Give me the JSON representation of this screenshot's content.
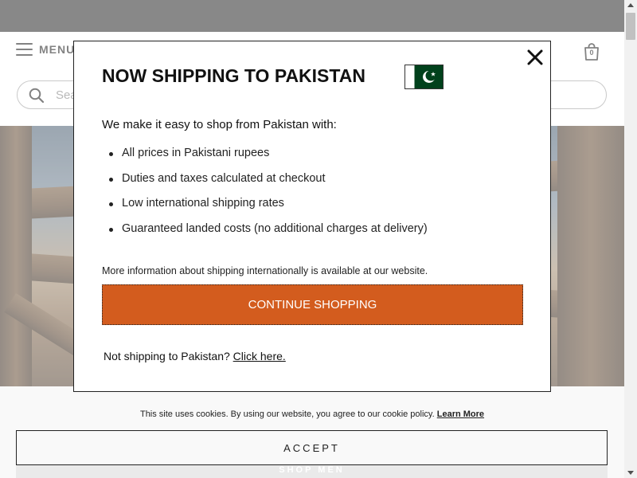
{
  "header": {
    "menu_label": "MENU",
    "cart_count": "0",
    "cart_icon": "shopping-bag-icon",
    "menu_icon": "hamburger-icon"
  },
  "search": {
    "placeholder": "Search",
    "icon": "search-icon"
  },
  "modal": {
    "title": "NOW SHIPPING TO PAKISTAN",
    "flag": "pakistan-flag-icon",
    "close_icon": "close-icon",
    "intro": "We make it easy to shop from Pakistan with:",
    "bullets": [
      "All prices in Pakistani rupees",
      "Duties and taxes calculated at checkout",
      "Low international shipping rates",
      "Guaranteed landed costs (no additional charges at delivery)"
    ],
    "info": "More information about shipping internationally is available at our website.",
    "continue_label": "CONTINUE SHOPPING",
    "not_shipping_text": "Not shipping to Pakistan?",
    "click_here_label": "Click here."
  },
  "cookie": {
    "text": "This site uses cookies. By using our website, you agree to our cookie policy.",
    "learn_more": "Learn More",
    "accept_label": "ACCEPT"
  },
  "below": {
    "shop_men_label": "SHOP MEN"
  },
  "colors": {
    "accent": "#d35c1e",
    "topbar": "#1b1b1b",
    "flag_green": "#01411c"
  }
}
